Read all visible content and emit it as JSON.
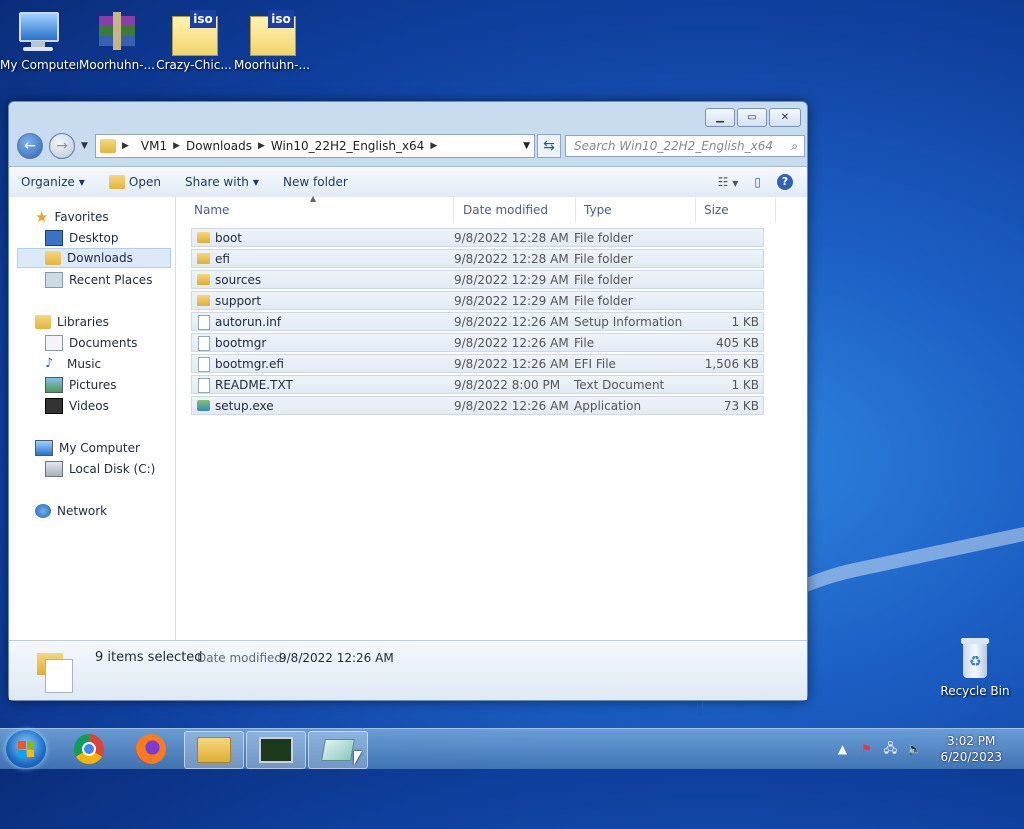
{
  "desktop": {
    "icons": [
      {
        "label": "My Computer"
      },
      {
        "label": "Moorhuhn-..."
      },
      {
        "label": "Crazy-Chic..."
      },
      {
        "label": "Moorhuhn-..."
      }
    ],
    "iso_badge": "iso",
    "recycle_bin": "Recycle Bin"
  },
  "window": {
    "address": [
      "VM1",
      "Downloads",
      "Win10_22H2_English_x64"
    ],
    "search_placeholder": "Search Win10_22H2_English_x64",
    "toolbar": {
      "organize": "Organize",
      "open": "Open",
      "share_with": "Share with",
      "new_folder": "New folder"
    },
    "nav": {
      "favorites": "Favorites",
      "desktop": "Desktop",
      "downloads": "Downloads",
      "recent_places": "Recent Places",
      "libraries": "Libraries",
      "documents": "Documents",
      "music": "Music",
      "pictures": "Pictures",
      "videos": "Videos",
      "my_computer": "My Computer",
      "local_disk": "Local Disk (C:)",
      "network": "Network"
    },
    "columns": {
      "name": "Name",
      "date": "Date modified",
      "type": "Type",
      "size": "Size"
    },
    "files": [
      {
        "name": "boot",
        "date": "9/8/2022 12:28 AM",
        "type": "File folder",
        "size": "",
        "kind": "folder"
      },
      {
        "name": "efi",
        "date": "9/8/2022 12:28 AM",
        "type": "File folder",
        "size": "",
        "kind": "folder"
      },
      {
        "name": "sources",
        "date": "9/8/2022 12:29 AM",
        "type": "File folder",
        "size": "",
        "kind": "folder"
      },
      {
        "name": "support",
        "date": "9/8/2022 12:29 AM",
        "type": "File folder",
        "size": "",
        "kind": "folder"
      },
      {
        "name": "autorun.inf",
        "date": "9/8/2022 12:26 AM",
        "type": "Setup Information",
        "size": "1 KB",
        "kind": "inf"
      },
      {
        "name": "bootmgr",
        "date": "9/8/2022 12:26 AM",
        "type": "File",
        "size": "405 KB",
        "kind": "file"
      },
      {
        "name": "bootmgr.efi",
        "date": "9/8/2022 12:26 AM",
        "type": "EFI File",
        "size": "1,506 KB",
        "kind": "file"
      },
      {
        "name": "README.TXT",
        "date": "9/8/2022 8:00 PM",
        "type": "Text Document",
        "size": "1 KB",
        "kind": "file"
      },
      {
        "name": "setup.exe",
        "date": "9/8/2022 12:26 AM",
        "type": "Application",
        "size": "73 KB",
        "kind": "exe"
      }
    ],
    "details": {
      "selected": "9 items selected",
      "date_label": "Date modified:",
      "date_value": "9/8/2022 12:26 AM"
    }
  },
  "taskbar": {
    "time": "3:02 PM",
    "date": "6/20/2023"
  }
}
